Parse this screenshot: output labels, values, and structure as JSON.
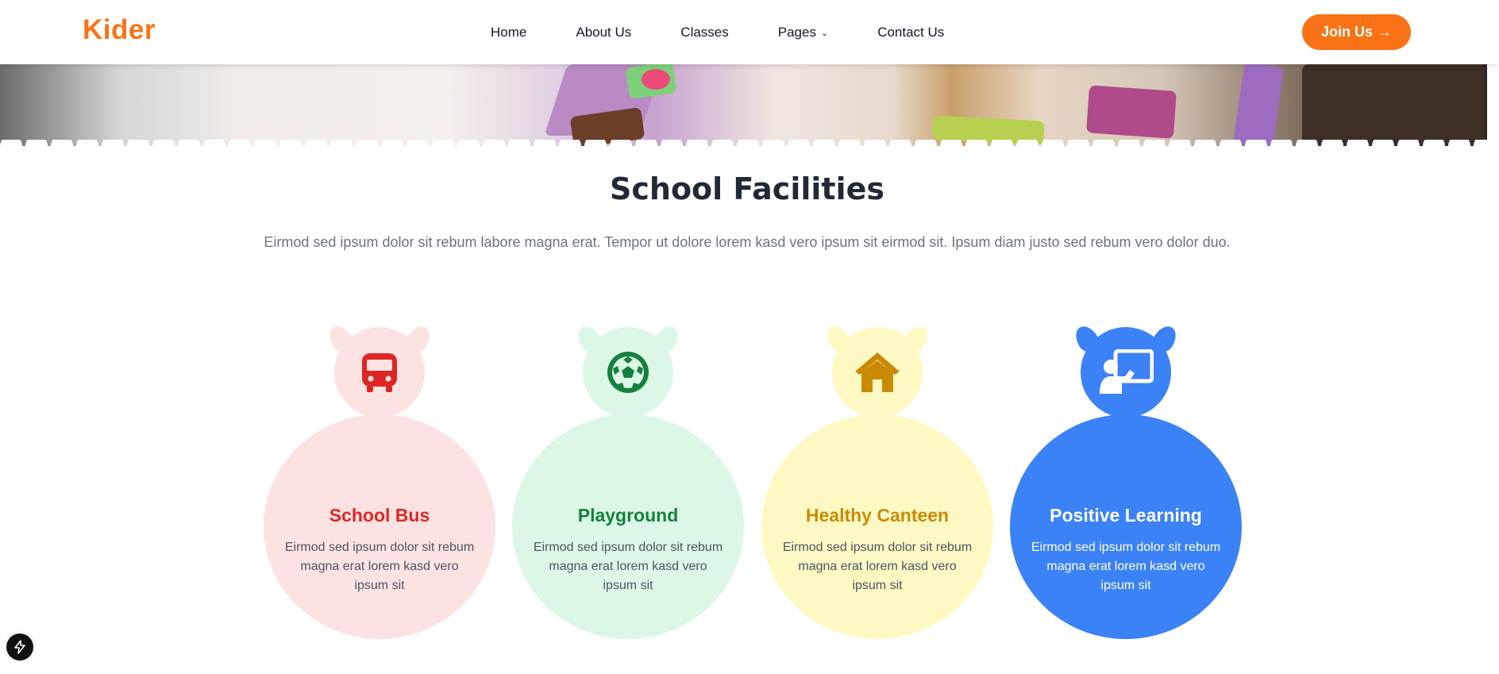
{
  "navbar": {
    "logo": "Kider",
    "links": [
      {
        "label": "Home"
      },
      {
        "label": "About Us"
      },
      {
        "label": "Classes"
      },
      {
        "label": "Pages",
        "has_dropdown": true
      },
      {
        "label": "Contact Us"
      }
    ],
    "cta_label": "Join Us",
    "cta_arrow": "→"
  },
  "section": {
    "title": "School Facilities",
    "subtitle": "Eirmod sed ipsum dolor sit rebum labore magna erat. Tempor ut dolore lorem kasd vero ipsum sit eirmod sit. Ipsum diam justo sed rebum vero dolor duo."
  },
  "facilities": [
    {
      "title": "School Bus",
      "text": "Eirmod sed ipsum dolor sit rebum magna erat lorem kasd vero ipsum sit",
      "icon": "bus-icon",
      "light": "#fde2e2",
      "accent": "#dc2626",
      "text_color": "#4b5563"
    },
    {
      "title": "Playground",
      "text": "Eirmod sed ipsum dolor sit rebum magna erat lorem kasd vero ipsum sit",
      "icon": "soccer-ball-icon",
      "light": "#dcf7e6",
      "accent": "#15803d",
      "text_color": "#4b5563"
    },
    {
      "title": "Healthy Canteen",
      "text": "Eirmod sed ipsum dolor sit rebum magna erat lorem kasd vero ipsum sit",
      "icon": "home-icon",
      "light": "#fef9c3",
      "accent": "#ca8a04",
      "text_color": "#4b5563"
    },
    {
      "title": "Positive Learning",
      "text": "Eirmod sed ipsum dolor sit rebum magna erat lorem kasd vero ipsum sit",
      "icon": "teacher-icon",
      "light": "#3b82f6",
      "accent": "#ffffff",
      "text_color": "#ffffff",
      "active": true
    }
  ],
  "colors": {
    "brand": "#f97316",
    "heading": "#1f2937",
    "muted": "#6b7280"
  }
}
